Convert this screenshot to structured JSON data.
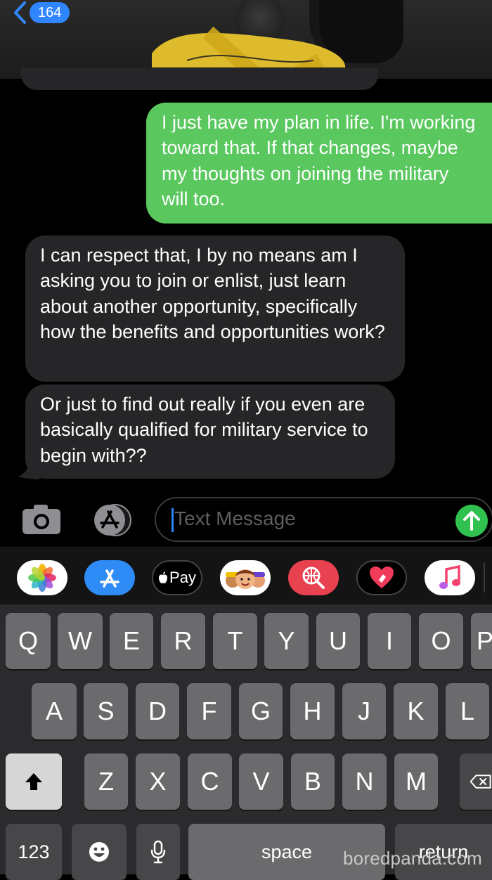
{
  "header": {
    "back_count": "164"
  },
  "messages": {
    "sent_1": "I just have my plan in life. I'm working toward that. If that changes, maybe my thoughts on joining the military will too.",
    "received_1": "I can respect that, I by no means am I asking you to join or enlist, just learn about another opportunity, specifically how the benefits and opportunities work?",
    "received_2": "Or just to find out really if you even are basically qualified for military service to begin with??"
  },
  "compose": {
    "placeholder": "Text Message"
  },
  "apps": [
    {
      "name": "photos-app-icon"
    },
    {
      "name": "app-store-app-icon"
    },
    {
      "name": "apple-pay-app-icon",
      "label": "Pay"
    },
    {
      "name": "memoji-app-icon"
    },
    {
      "name": "images-search-app-icon"
    },
    {
      "name": "digital-touch-app-icon"
    },
    {
      "name": "music-app-icon"
    }
  ],
  "keyboard": {
    "row1": [
      "Q",
      "W",
      "E",
      "R",
      "T",
      "Y",
      "U",
      "I",
      "O",
      "P"
    ],
    "row2": [
      "A",
      "S",
      "D",
      "F",
      "G",
      "H",
      "J",
      "K",
      "L"
    ],
    "row3": [
      "Z",
      "X",
      "C",
      "V",
      "B",
      "N",
      "M"
    ],
    "numbers_label": "123",
    "space_label": "space",
    "return_label": "return"
  },
  "watermark": "boredpanda.com",
  "colors": {
    "sent_bubble": "#5ac85f",
    "received_bubble": "#262628",
    "accent": "#2f86ff",
    "send_button": "#30c04f"
  }
}
